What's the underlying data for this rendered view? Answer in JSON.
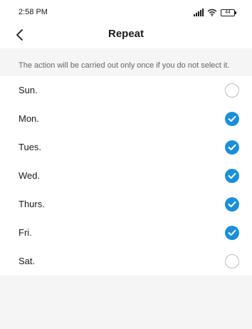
{
  "status_bar": {
    "time": "2:58 PM",
    "battery_level": "44"
  },
  "header": {
    "title": "Repeat",
    "back_icon": "chevron-left-icon"
  },
  "hint": "The action will be carried out only once if you do not select it.",
  "colors": {
    "accent": "#1a8fdb",
    "background": "#f5f5f5",
    "surface": "#ffffff"
  },
  "days": [
    {
      "label": "Sun.",
      "selected": false
    },
    {
      "label": "Mon.",
      "selected": true
    },
    {
      "label": "Tues.",
      "selected": true
    },
    {
      "label": "Wed.",
      "selected": true
    },
    {
      "label": "Thurs.",
      "selected": true
    },
    {
      "label": "Fri.",
      "selected": true
    },
    {
      "label": "Sat.",
      "selected": false
    }
  ]
}
